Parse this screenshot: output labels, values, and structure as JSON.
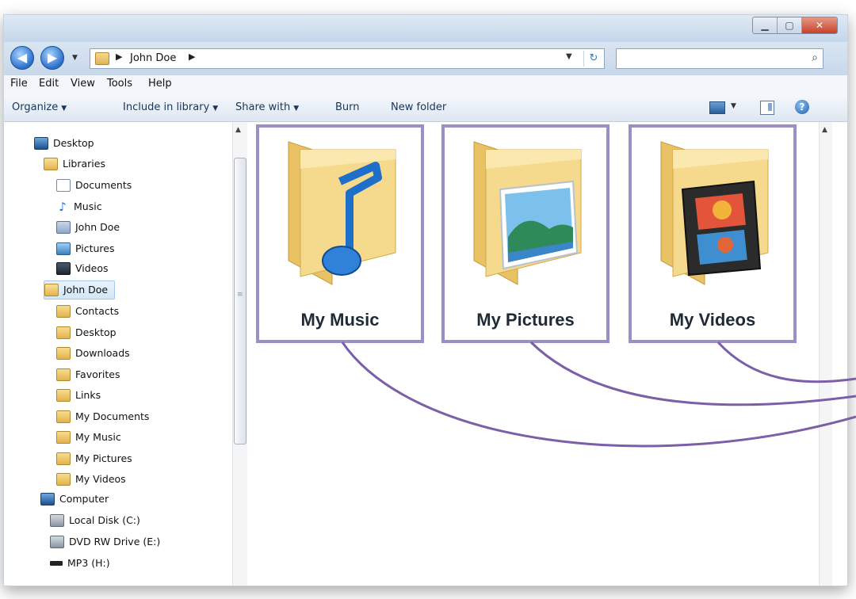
{
  "window": {
    "title_buttons": {
      "minimize_icon": "minimize-icon",
      "maximize_icon": "maximize-icon",
      "close_icon": "close-icon"
    }
  },
  "address_bar": {
    "path": [
      "John Doe"
    ],
    "search_placeholder": ""
  },
  "menu": [
    "File",
    "Edit",
    "View",
    "Tools",
    "Help"
  ],
  "toolbar": {
    "organize": "Organize",
    "include_in_library": "Include in library",
    "share_with": "Share with",
    "burn": "Burn",
    "new_folder": "New folder"
  },
  "sidebar": {
    "items": [
      {
        "label": "Desktop",
        "icon": "desktop-icon"
      },
      {
        "label": "Libraries",
        "icon": "libraries-icon"
      },
      {
        "label": "Documents",
        "icon": "documents-icon"
      },
      {
        "label": "Music",
        "icon": "music-icon"
      },
      {
        "label": "John Doe",
        "icon": "user-folder-icon"
      },
      {
        "label": "Pictures",
        "icon": "pictures-icon"
      },
      {
        "label": "Videos",
        "icon": "videos-icon"
      },
      {
        "label": "John Doe",
        "icon": "user-icon",
        "selected": true
      },
      {
        "label": "Contacts",
        "icon": "folder-icon"
      },
      {
        "label": "Desktop",
        "icon": "folder-icon"
      },
      {
        "label": "Downloads",
        "icon": "folder-icon"
      },
      {
        "label": "Favorites",
        "icon": "folder-icon"
      },
      {
        "label": "Links",
        "icon": "folder-icon"
      },
      {
        "label": "My Documents",
        "icon": "folder-icon"
      },
      {
        "label": "My Music",
        "icon": "folder-icon"
      },
      {
        "label": "My Pictures",
        "icon": "folder-icon"
      },
      {
        "label": "My Videos",
        "icon": "folder-icon"
      },
      {
        "label": "Computer",
        "icon": "computer-icon"
      },
      {
        "label": "Local Disk (C:)",
        "icon": "disk-icon"
      },
      {
        "label": "DVD RW Drive (E:)",
        "icon": "dvd-icon"
      },
      {
        "label": "MP3 (H:)",
        "icon": "mp3-icon"
      }
    ]
  },
  "folders": [
    {
      "label": "My Music",
      "icon": "music-folder-icon"
    },
    {
      "label": "My Pictures",
      "icon": "pictures-folder-icon"
    },
    {
      "label": "My Videos",
      "icon": "videos-folder-icon"
    }
  ],
  "colors": {
    "highlight_border": "#9b8fc4",
    "connector": "#7b5fa8"
  }
}
